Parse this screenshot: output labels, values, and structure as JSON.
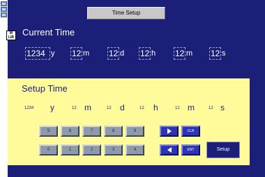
{
  "window": {
    "strip_icons": [
      "app-icon",
      "app-icon",
      "app-icon"
    ]
  },
  "header": {
    "title": "Time Setup",
    "lib_icon_text": "M LIB"
  },
  "current": {
    "label": "Current Time",
    "year": "1234",
    "year_unit": "y",
    "month": "12",
    "month_unit": "m",
    "day": "12",
    "day_unit": "d",
    "hour": "12",
    "hour_unit": "h",
    "minute": "12",
    "minute_unit": "m",
    "second": "12",
    "second_unit": "s"
  },
  "setup": {
    "label": "Setup Time",
    "year": "1234",
    "year_unit": "y",
    "month": "12",
    "month_unit": "m",
    "day": "12",
    "day_unit": "d",
    "hour": "12",
    "hour_unit": "h",
    "minute": "12",
    "minute_unit": "m",
    "second": "12",
    "second_unit": "s"
  },
  "keypad": {
    "row1": [
      "5",
      "6",
      "7",
      "8",
      "9"
    ],
    "row2": [
      "0",
      "1",
      "2",
      "3",
      "4"
    ],
    "right_icon": "right-arrow-icon",
    "left_icon": "left-arrow-icon",
    "clear_label": "CLR",
    "enter_label": "ENT",
    "setup_label": "Setup"
  },
  "colors": {
    "background": "#1c1f78",
    "panel": "#fffb9a",
    "key": "#8e99a9",
    "accent_key": "#2d34b4"
  }
}
